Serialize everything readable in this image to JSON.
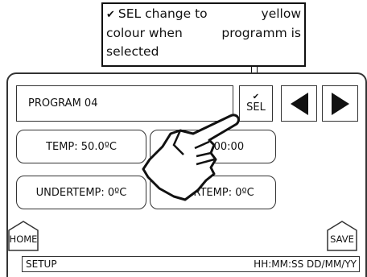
{
  "callout": {
    "check": "✔",
    "line1_a": "SEL change to",
    "line1_b": "yellow",
    "line2_a": "colour when",
    "line2_b": "programm is",
    "line3": "selected"
  },
  "program": {
    "label": "PROGRAM 04"
  },
  "sel_button": {
    "check": "✔",
    "label": "SEL"
  },
  "nav": {
    "prev_icon": "left-arrow-icon",
    "next_icon": "right-arrow-icon"
  },
  "fields": {
    "temp": "TEMP: 50.0ºC",
    "time": "TIME: 00:00",
    "undertemp": "UNDERTEMP: 0ºC",
    "overtemp": "OVERTEMP: 0ºC"
  },
  "buttons": {
    "home": "HOME",
    "save": "SAVE"
  },
  "status": {
    "left": "SETUP",
    "right": "HH:MM:SS DD/MM/YY"
  },
  "colors": {
    "border": "#333333",
    "background": "#ffffff",
    "selected": "#ffff00"
  }
}
